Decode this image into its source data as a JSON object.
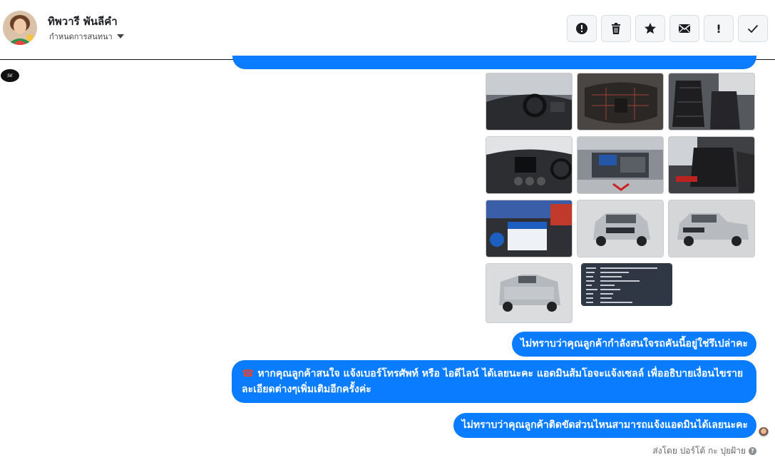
{
  "header": {
    "contact_name": "ทิพวารี พันลีคำ",
    "assign_label": "กำหนดการสนทนา"
  },
  "toolbar": [
    {
      "name": "report-button",
      "icon": "alert-circle-icon"
    },
    {
      "name": "delete-button",
      "icon": "trash-icon"
    },
    {
      "name": "star-button",
      "icon": "star-icon"
    },
    {
      "name": "mark-unread-button",
      "icon": "envelope-icon"
    },
    {
      "name": "important-button",
      "icon": "exclamation-icon",
      "glyph": "!"
    },
    {
      "name": "done-button",
      "icon": "check-icon"
    }
  ],
  "page_logo_text": "SK",
  "gallery": {
    "photos": [
      {
        "name": "photo-interior-dashboard",
        "bg": "#5b5f66"
      },
      {
        "name": "photo-center-console",
        "bg": "#3e3a38"
      },
      {
        "name": "photo-front-seats",
        "bg": "#444446"
      },
      {
        "name": "photo-dashboard-radio",
        "bg": "#2f3134"
      },
      {
        "name": "photo-engine-bay",
        "bg": "#6c7078"
      },
      {
        "name": "photo-rear-seats",
        "bg": "#3d3f42"
      },
      {
        "name": "photo-engine-battery",
        "bg": "#1f3a6b"
      },
      {
        "name": "photo-truck-front",
        "bg": "#c8cacc"
      },
      {
        "name": "photo-truck-front-side",
        "bg": "#c6c8ca"
      },
      {
        "name": "photo-truck-rear",
        "bg": "#cdcfd1"
      },
      {
        "name": "photo-document-screenshot",
        "bg": "#2f3744"
      }
    ]
  },
  "messages": [
    {
      "text": "ไม่ทราบว่าคุณลูกค้ากำลังสนใจรถคันนี้อยู่ใช่รึเปล่าคะ"
    },
    {
      "text": "หากคุณลูกค้าสนใจ แจ้งเบอร์โทรศัพท์ หรือ ไอดีไลน์  ได้เลยนะคะ แอดมินส้มโอจะแจ้งเซลล์   เพื่ออธิบายเงื่อนไขรายละเอียดต่างๆเพิ่มเติมอีกครั้งค่ะ",
      "emoji_lead": "☎",
      "emoji_mid": "🥰"
    },
    {
      "text": "ไม่ทราบว่าคุณลูกค้าติดขัดส่วนไหนสามารถแจ้งแอดมินได้เลยนะคะ"
    }
  ],
  "sent_by": "ส่งโดย ปอร์โต้ กะ ปุยฝ้าย",
  "colors": {
    "bubble": "#0a7cff"
  }
}
